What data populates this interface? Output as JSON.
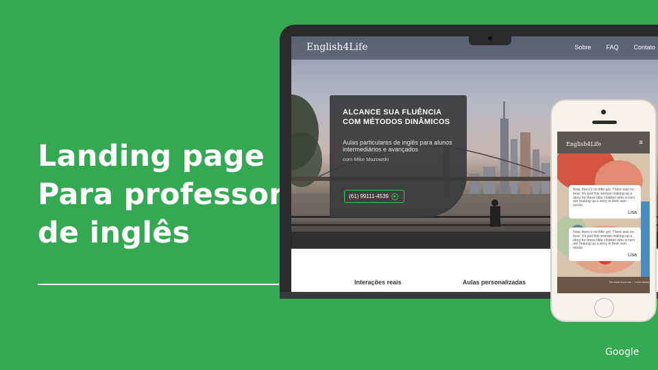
{
  "slide": {
    "title_lines": [
      "Landing page",
      "Para professor",
      "de inglês"
    ],
    "brand": "Google",
    "colors": {
      "background": "#34a853",
      "cta_border": "#2ecc57"
    }
  },
  "site": {
    "logo": "English4Life",
    "nav": [
      "Sobre",
      "FAQ",
      "Contato"
    ],
    "hero": {
      "headline": "ALCANCE SUA FLUÊNCIA COM MÉTODOS DINÂMICOS",
      "subtitle": "Aulas particulares de inglês para alunos intermediários e avançados",
      "byline": "com Mike Mazowski",
      "cta_label": "(61) 99111-4539",
      "cta_icon": "whatsapp-icon"
    },
    "sections": [
      "Interações reais",
      "Aulas personalizadas"
    ]
  },
  "mobile": {
    "logo": "English4Life",
    "menu_icon": "≡",
    "testimonials": [
      {
        "text": "Now, there's no little girl. There was no bear. It's just this woman making up a story for these little children who in turn are making up a story in their own minds.",
        "name": "Lisa"
      },
      {
        "text": "Now, there's no little girl. There was no bear. It's just this woman making up a story for these little children who in turn are making up a story in their own minds.",
        "name": "Lisa"
      }
    ],
    "caption": "The result is you can ... Lorem ipsum"
  }
}
